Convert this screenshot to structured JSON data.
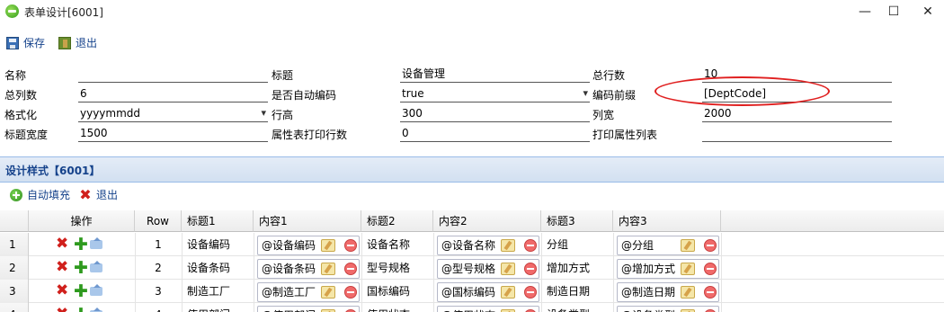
{
  "window": {
    "title": "表单设计[6001]",
    "minimize": "—",
    "maximize": "☐",
    "close": "✕"
  },
  "toolbar": {
    "save_label": "保存",
    "exit_label": "退出"
  },
  "form": {
    "name_label": "名称",
    "name_value": "",
    "title_label": "标题",
    "title_value": "设备管理",
    "total_rows_label": "总行数",
    "total_rows_value": "10",
    "total_cols_label": "总列数",
    "total_cols_value": "6",
    "auto_code_label": "是否自动编码",
    "auto_code_value": "true",
    "code_prefix_label": "编码前缀",
    "code_prefix_value": "[DeptCode]",
    "format_label": "格式化",
    "format_value": "yyyymmdd",
    "row_height_label": "行高",
    "row_height_value": "300",
    "col_width_label": "列宽",
    "col_width_value": "2000",
    "title_width_label": "标题宽度",
    "title_width_value": "1500",
    "print_rows_label": "属性表打印行数",
    "print_rows_value": "0",
    "print_cols_label": "打印属性列表",
    "print_cols_value": ""
  },
  "panel": {
    "title": "设计样式【6001】",
    "autofill_label": "自动填充",
    "exit_label": "退出"
  },
  "grid": {
    "headers": {
      "ops": "操作",
      "row": "Row",
      "title1": "标题1",
      "content1": "内容1",
      "title2": "标题2",
      "content2": "内容2",
      "title3": "标题3",
      "content3": "内容3"
    },
    "rows": [
      {
        "num": "1",
        "row": "1",
        "title1": "设备编码",
        "content1": "@设备编码",
        "title2": "设备名称",
        "content2": "@设备名称",
        "title3": "分组",
        "content3": "@分组"
      },
      {
        "num": "2",
        "row": "2",
        "title1": "设备条码",
        "content1": "@设备条码",
        "title2": "型号规格",
        "content2": "@型号规格",
        "title3": "增加方式",
        "content3": "@增加方式"
      },
      {
        "num": "3",
        "row": "3",
        "title1": "制造工厂",
        "content1": "@制造工厂",
        "title2": "国标编码",
        "content2": "@国标编码",
        "title3": "制造日期",
        "content3": "@制造日期"
      },
      {
        "num": "4",
        "row": "4",
        "title1": "使用部门",
        "content1": "@使用部门",
        "title2": "使用状态",
        "content2": "@使用状态",
        "title3": "设备类型",
        "content3": "@设备类型"
      }
    ]
  },
  "colors": {
    "link": "#15428b",
    "panel_header": "#d2e0f1",
    "highlight": "#e02020"
  }
}
